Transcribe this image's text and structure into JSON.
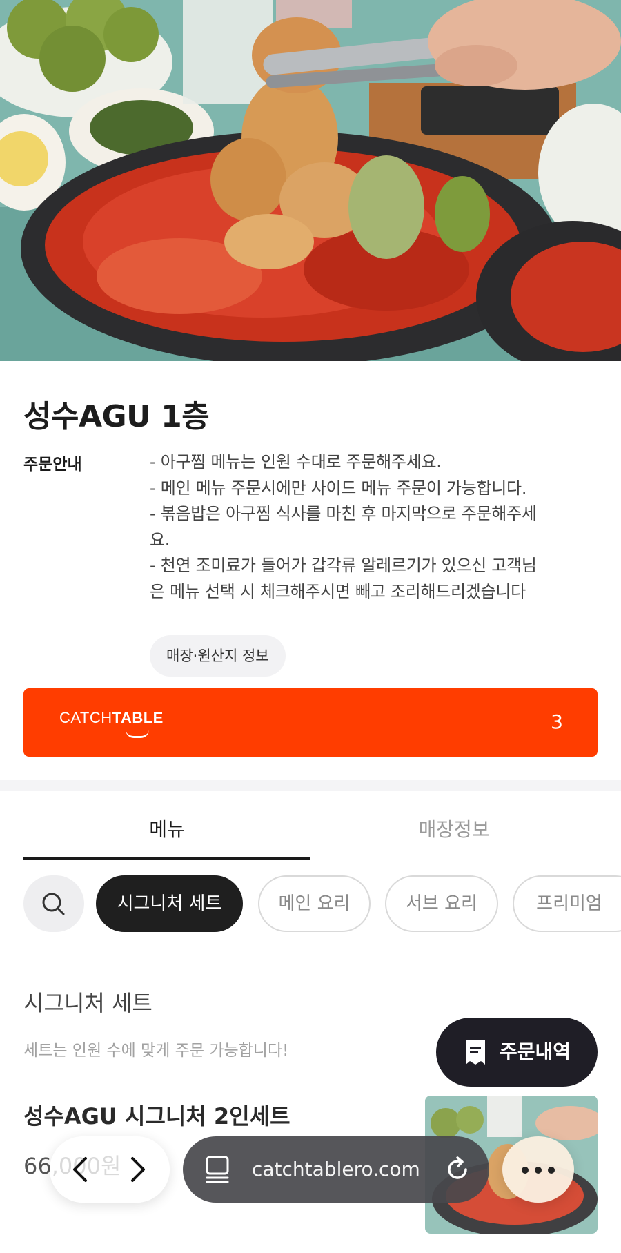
{
  "store": {
    "title": "성수AGU 1층",
    "notice_label": "주문안내",
    "notice_lines": [
      "- 아구찜 메뉴는 인원 수대로 주문해주세요.",
      "- 메인 메뉴 주문시에만 사이드 메뉴 주문이 가능합니다.",
      "- 볶음밥은 아구찜 식사를 마친 후 마지막으로 주문해주세",
      "요.",
      "- 천연 조미료가 들어가 갑각류 알레르기가 있으신 고객님",
      "은 메뉴 선택 시 체크해주시면 빼고 조리해드리겠습니다"
    ],
    "origin_button": "매장·원산지 정보"
  },
  "catchtable": {
    "logo_light": "CATCH",
    "logo_bold": "TABLE",
    "count": "3",
    "color": "#ff3d00"
  },
  "tabs": [
    {
      "label": "메뉴",
      "active": true
    },
    {
      "label": "매장정보",
      "active": false
    }
  ],
  "categories": [
    {
      "label": "시그니처 세트",
      "active": true
    },
    {
      "label": "메인 요리",
      "active": false
    },
    {
      "label": "서브 요리",
      "active": false
    },
    {
      "label": "프리미엄",
      "active": false
    }
  ],
  "section": {
    "title": "시그니처 세트",
    "description": "세트는 인원 수에 맞게 주문 가능합니다!"
  },
  "item": {
    "name": "성수AGU 시그니처 2인세트",
    "price": "66,000원"
  },
  "order_history": {
    "label": "주문내역"
  },
  "browser": {
    "url": "catchtablero.com",
    "icons": [
      "back-icon",
      "forward-icon",
      "tabs-icon",
      "reload-icon",
      "more-icon"
    ]
  }
}
